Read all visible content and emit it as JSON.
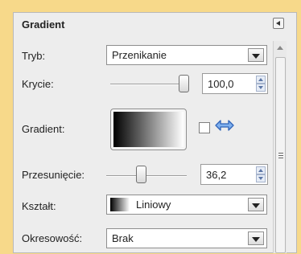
{
  "panel": {
    "title": "Gradient",
    "menu_icon": "triangle-left-icon"
  },
  "fields": {
    "mode": {
      "label": "Tryb:",
      "value": "Przenikanie"
    },
    "opacity": {
      "label": "Krycie:",
      "value": "100,0",
      "slider_fraction": 1.0
    },
    "gradient": {
      "label": "Gradient:",
      "reverse_icon": "swap-arrows-icon"
    },
    "offset": {
      "label": "Przesunięcie:",
      "value": "36,2",
      "slider_fraction": 0.36
    },
    "shape": {
      "label": "Kształt:",
      "value": "Liniowy"
    },
    "repeat": {
      "label": "Okresowość:",
      "value": "Brak"
    }
  },
  "colors": {
    "background": "#f7d98a",
    "panel": "#ededed",
    "swap_icon": "#3b6fc4"
  }
}
